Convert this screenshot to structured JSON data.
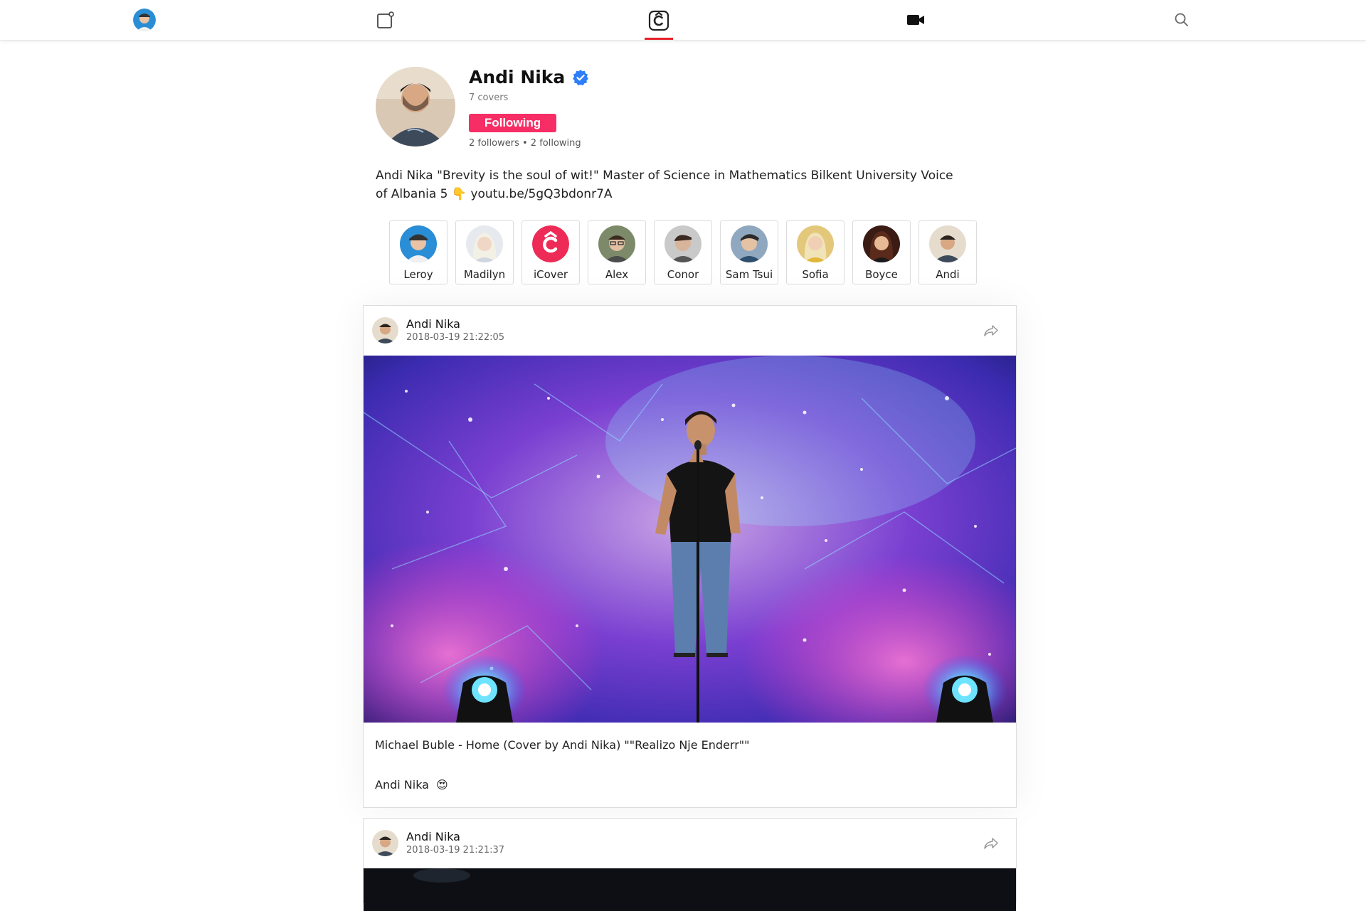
{
  "nav": {
    "items": [
      "profile-avatar",
      "compose-icon",
      "icover-home-icon",
      "video-camera-icon",
      "search-icon"
    ],
    "active": "icover-home-icon",
    "accent": "#e8202a"
  },
  "profile": {
    "name": "Andi Nika",
    "verified": true,
    "covers": "7 covers",
    "follow_label": "Following",
    "follow_color": "#f72d65",
    "stats": "2 followers • 2 following",
    "bio": "Andi Nika \"Brevity is the soul of wit!\" Master of Science in Mathematics Bilkent University Voice of Albania 5 👇 youtu.be/5gQ3bdonr7A"
  },
  "following": [
    {
      "name": "Leroy"
    },
    {
      "name": "Madilyn"
    },
    {
      "name": "iCover"
    },
    {
      "name": "Alex"
    },
    {
      "name": "Conor"
    },
    {
      "name": "Sam Tsui"
    },
    {
      "name": "Sofia"
    },
    {
      "name": "Boyce"
    },
    {
      "name": "Andi"
    }
  ],
  "posts": [
    {
      "author": "Andi Nika",
      "date": "2018-03-19 21:22:05",
      "title": "Michael Buble - Home (Cover by Andi Nika) \"\"Realizo Nje Enderr\"\"",
      "subtitle": "Andi Nika",
      "emoji": "😍"
    },
    {
      "author": "Andi Nika",
      "date": "2018-03-19 21:21:37"
    }
  ]
}
